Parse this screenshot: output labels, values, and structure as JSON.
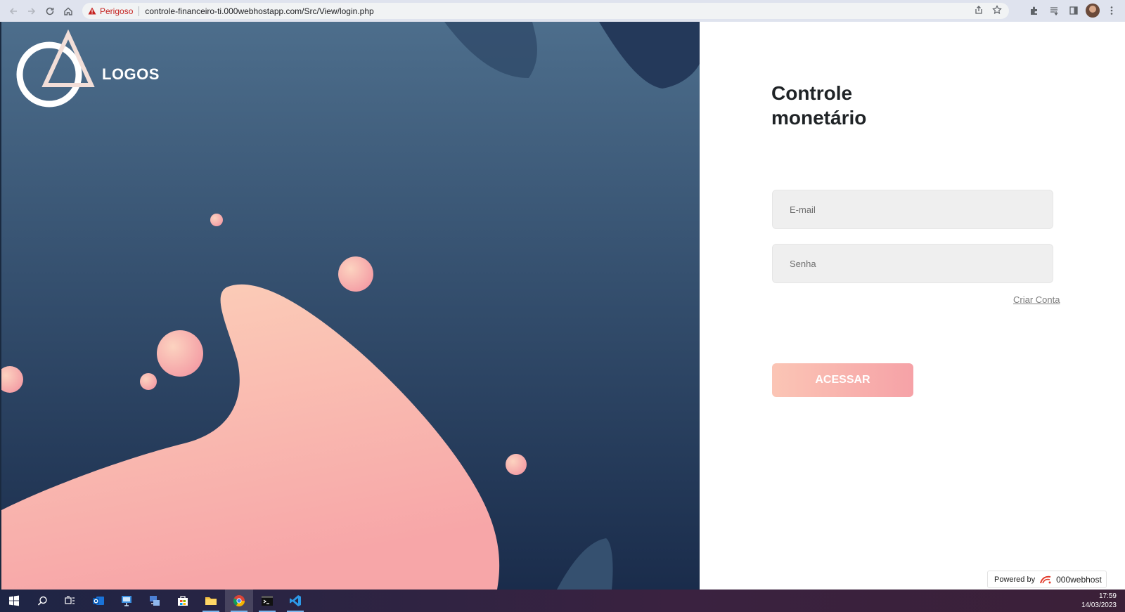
{
  "browser": {
    "security_label": "Perigoso",
    "url": "controle-financeiro-ti.000webhostapp.com/Src/View/login.php"
  },
  "brand": {
    "logo_text": "LOGOS"
  },
  "login": {
    "title_line1": "Controle",
    "title_line2": "monetário",
    "email_placeholder": "E-mail",
    "password_placeholder": "Senha",
    "create_account": "Criar Conta",
    "submit": "ACESSAR"
  },
  "footer": {
    "powered_by": "Powered by",
    "host_name": "000webhost"
  },
  "taskbar": {
    "time": "17:59",
    "date": "14/03/2023"
  },
  "colors": {
    "panel_top": "#4a6b88",
    "panel_bottom": "#1b2e4e",
    "accent_pink": "#f6a2a7",
    "accent_peach": "#fbc5b5"
  }
}
